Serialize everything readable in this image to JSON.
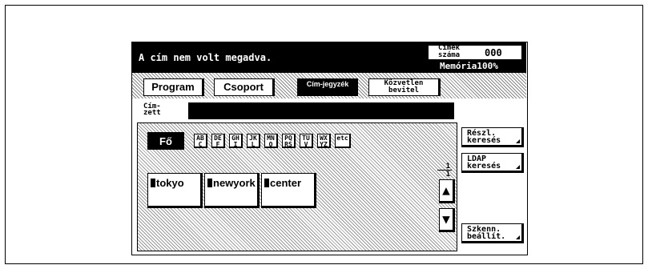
{
  "message": {
    "text": "A cím nem volt megadva."
  },
  "counter": {
    "label": "Címek száma",
    "value": "000"
  },
  "memory": "Memória100%",
  "tabs": [
    {
      "label": "Program",
      "active": false
    },
    {
      "label": "Csoport",
      "active": false
    },
    {
      "label": "Cím-jegyzék",
      "active": true
    },
    {
      "label": "Közvetlen bevitel",
      "active": false
    }
  ],
  "recipient": {
    "label": "Cím-zett",
    "value": ""
  },
  "index_tabs": [
    "Fő",
    "AB C",
    "DE F",
    "GH I",
    "JK L",
    "MN O",
    "PQ RS",
    "TU V",
    "WX YZ",
    "etc"
  ],
  "entries": [
    "tokyo",
    "newyork",
    "center"
  ],
  "paging": {
    "current": "1",
    "total": "1"
  },
  "side_buttons": [
    "Részl. keresés",
    "LDAP keresés",
    "Szkenn. beállít."
  ],
  "icons": {
    "up": "up-arrow-icon",
    "down": "down-arrow-icon"
  }
}
